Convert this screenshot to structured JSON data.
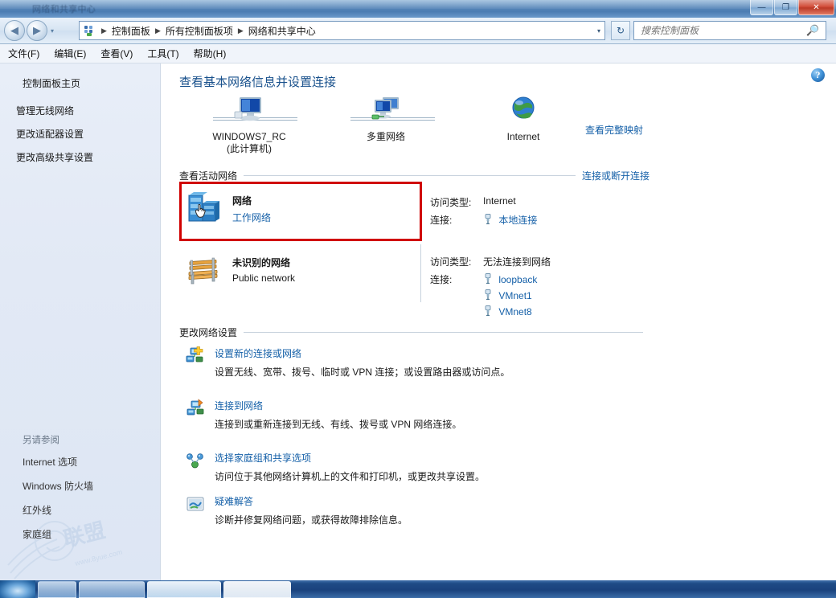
{
  "window": {
    "title": "网络和共享中心",
    "controls": {
      "minimize": "—",
      "restore": "❐",
      "close": "✕"
    }
  },
  "nav": {
    "back_icon": "◀",
    "forward_icon": "▶",
    "history_caret": "▾",
    "breadcrumb": [
      "控制面板",
      "所有控制面板项",
      "网络和共享中心"
    ],
    "address_caret": "▾",
    "refresh_icon": "↻",
    "search_placeholder": "搜索控制面板",
    "search_value": ""
  },
  "menubar": [
    "文件(F)",
    "编辑(E)",
    "查看(V)",
    "工具(T)",
    "帮助(H)"
  ],
  "sidebar": {
    "home": "控制面板主页",
    "links": [
      "管理无线网络",
      "更改适配器设置",
      "更改高级共享设置"
    ],
    "also_title": "另请参阅",
    "also_links": [
      "Internet 选项",
      "Windows 防火墙",
      "红外线",
      "家庭组"
    ]
  },
  "main": {
    "help_glyph": "?",
    "page_title": "查看基本网络信息并设置连接",
    "netmap": {
      "nodes": [
        {
          "icon": "computer-icon",
          "label": "WINDOWS7_RC",
          "label2": "(此计算机)"
        },
        {
          "icon": "multiple-networks-icon",
          "label": "多重网络",
          "label2": ""
        },
        {
          "icon": "internet-globe-icon",
          "label": "Internet",
          "label2": ""
        }
      ],
      "full_map_link": "查看完整映射"
    },
    "active_section": {
      "title": "查看活动网络",
      "action": "连接或断开连接",
      "networks": [
        {
          "icon": "workgroup-server-icon",
          "name": "网络",
          "type": "工作网络",
          "highlighted": true,
          "access_label": "访问类型:",
          "access_value": "Internet",
          "conn_label": "连接:",
          "connections": [
            "本地连接"
          ]
        },
        {
          "icon": "park-bench-icon",
          "name": "未识别的网络",
          "type": "Public network",
          "highlighted": false,
          "access_label": "访问类型:",
          "access_value": "无法连接到网络",
          "conn_label": "连接:",
          "connections": [
            "loopback",
            "VMnet1",
            "VMnet8"
          ]
        }
      ]
    },
    "change_section": {
      "title": "更改网络设置",
      "options": [
        {
          "icon": "new-connection-icon",
          "title": "设置新的连接或网络",
          "desc": "设置无线、宽带、拨号、临时或 VPN 连接；或设置路由器或访问点。"
        },
        {
          "icon": "connect-to-network-icon",
          "title": "连接到网络",
          "desc": "连接到或重新连接到无线、有线、拨号或 VPN 网络连接。"
        },
        {
          "icon": "homegroup-sharing-icon",
          "title": "选择家庭组和共享选项",
          "desc": "访问位于其他网络计算机上的文件和打印机，或更改共享设置。"
        },
        {
          "icon": "troubleshoot-icon",
          "title": "疑难解答",
          "desc": "诊断并修复网络问题，或获得故障排除信息。"
        }
      ]
    }
  },
  "taskbar": {
    "clock": ""
  },
  "colors": {
    "link": "#1560a8",
    "title": "#19518c",
    "highlight_box": "#d00000",
    "sidebar_bg": "#e3eaf5",
    "titlebar": "#4b7cb2"
  }
}
